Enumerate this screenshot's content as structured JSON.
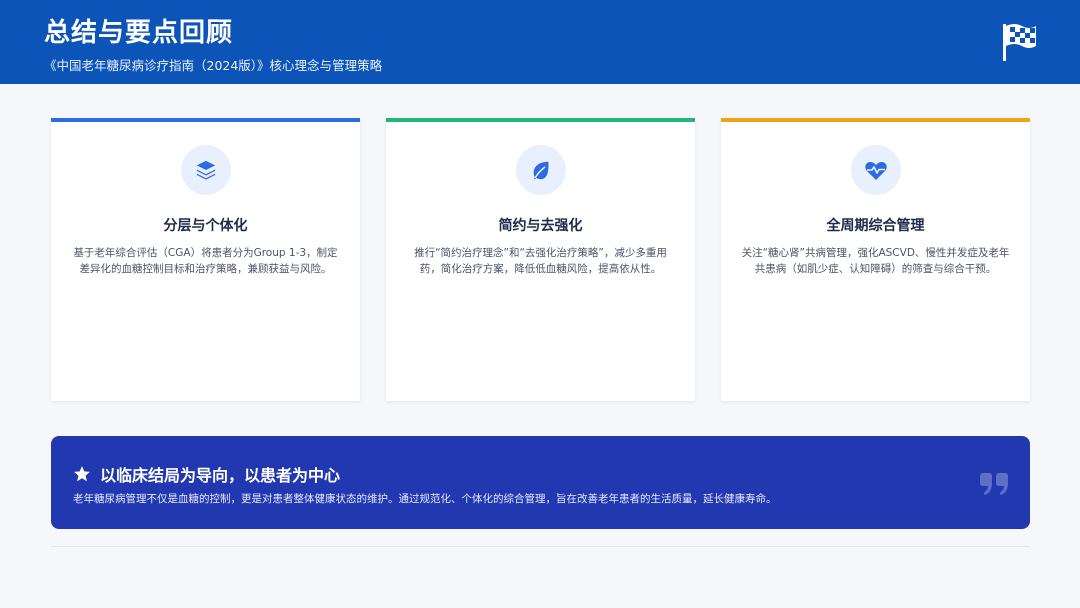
{
  "header": {
    "title": "总结与要点回顾",
    "subtitle": "《中国老年糖尿病诊疗指南（2024版）》核心理念与管理策略",
    "icon": "checkered-flag-icon"
  },
  "cards": [
    {
      "icon": "layers-icon",
      "accent": "#2f6be0",
      "title": "分层与个体化",
      "desc": "基于老年综合评估（CGA）将患者分为Group 1-3，制定差异化的血糖控制目标和治疗策略，兼顾获益与风险。"
    },
    {
      "icon": "leaf-icon",
      "accent": "#1fb876",
      "title": "简约与去强化",
      "desc": "推行“简约治疗理念”和“去强化治疗策略”，减少多重用药，简化治疗方案，降低低血糖风险，提高依从性。"
    },
    {
      "icon": "heartbeat-icon",
      "accent": "#f2a417",
      "title": "全周期综合管理",
      "desc": "关注“糖心肾”共病管理，强化ASCVD、慢性并发症及老年共患病（如肌少症、认知障碍）的筛查与综合干预。"
    }
  ],
  "banner": {
    "icon": "star-icon",
    "title": "以临床结局为导向，以患者为中心",
    "desc": "老年糖尿病管理不仅是血糖的控制，更是对患者整体健康状态的维护。通过规范化、个体化的综合管理，旨在改善老年患者的生活质量，延长健康寿命。",
    "quote_icon": "quote-icon"
  },
  "colors": {
    "header_bg": "#0d54b8",
    "banner_bg": "#2138b0",
    "icon_color": "#2f6be0"
  }
}
